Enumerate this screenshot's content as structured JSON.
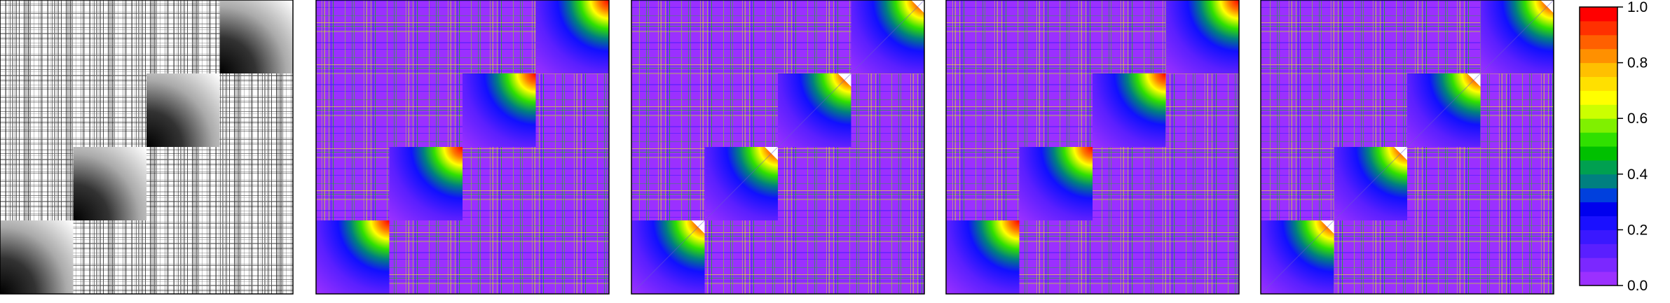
{
  "chart_data": [
    {
      "type": "heatmap",
      "title": "",
      "style": "adjacency",
      "blocks_r": 4,
      "blocks_c": 4,
      "block_pattern": "anti-diagonal",
      "colormap": "none"
    },
    {
      "type": "heatmap",
      "title": "",
      "style": "noisy",
      "blocks_r": 4,
      "blocks_c": 4,
      "block_pattern": "anti-diagonal",
      "colormap": "rainbow"
    },
    {
      "type": "heatmap",
      "title": "",
      "style": "smooth",
      "blocks_r": 4,
      "blocks_c": 4,
      "block_pattern": "anti-diagonal",
      "colormap": "rainbow"
    },
    {
      "type": "heatmap",
      "title": "",
      "style": "noisy",
      "blocks_r": 4,
      "blocks_c": 4,
      "block_pattern": "anti-diagonal",
      "colormap": "rainbow"
    },
    {
      "type": "heatmap",
      "title": "",
      "style": "smooth",
      "blocks_r": 4,
      "blocks_c": 4,
      "block_pattern": "anti-diagonal",
      "colormap": "rainbow"
    }
  ],
  "colorbar": {
    "range": [
      0,
      1
    ],
    "ticks": [
      "0.0",
      "0.2",
      "0.4",
      "0.6",
      "0.8",
      "1.0"
    ],
    "colors": [
      "#9b30ff",
      "#7b28ff",
      "#5a1fff",
      "#3a18ff",
      "#1a10ff",
      "#0000ee",
      "#0040dd",
      "#008080",
      "#00a050",
      "#00c000",
      "#30e000",
      "#80f000",
      "#ccff00",
      "#ffff00",
      "#ffe000",
      "#ffc000",
      "#ff9000",
      "#ff6000",
      "#ff3000",
      "#ff0000"
    ]
  }
}
